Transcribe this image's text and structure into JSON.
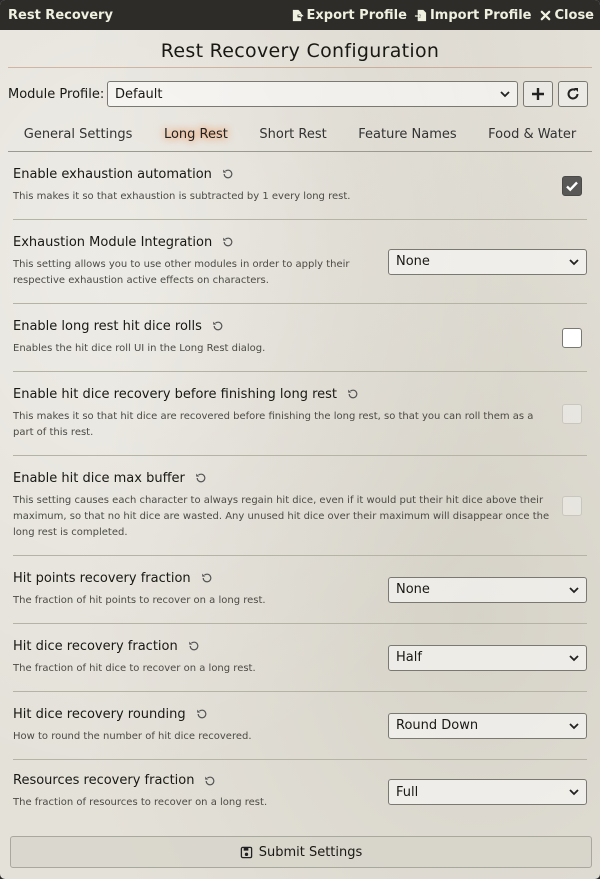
{
  "window": {
    "title": "Rest Recovery",
    "export_label": "Export Profile",
    "import_label": "Import Profile",
    "close_label": "Close"
  },
  "heading": "Rest Recovery Configuration",
  "profile": {
    "label": "Module Profile:",
    "value": "Default"
  },
  "tabs": [
    {
      "label": "General Settings",
      "active": false
    },
    {
      "label": "Long Rest",
      "active": true
    },
    {
      "label": "Short Rest",
      "active": false
    },
    {
      "label": "Feature Names",
      "active": false
    },
    {
      "label": "Food & Water",
      "active": false
    }
  ],
  "settings": [
    {
      "label": "Enable exhaustion automation",
      "hint": "This makes it so that exhaustion is subtracted by 1 every long rest.",
      "control": "checkbox",
      "checked": true,
      "disabled": false
    },
    {
      "label": "Exhaustion Module Integration",
      "hint": "This setting allows you to use other modules in order to apply their respective exhaustion active effects on characters.",
      "control": "select",
      "value": "None"
    },
    {
      "label": "Enable long rest hit dice rolls",
      "hint": "Enables the hit dice roll UI in the Long Rest dialog.",
      "control": "checkbox",
      "checked": false,
      "disabled": false
    },
    {
      "label": "Enable hit dice recovery before finishing long rest",
      "hint": "This makes it so that hit dice are recovered before finishing the long rest, so that you can roll them as a part of this rest.",
      "control": "checkbox",
      "checked": false,
      "disabled": true
    },
    {
      "label": "Enable hit dice max buffer",
      "hint": "This setting causes each character to always regain hit dice, even if it would put their hit dice above their maximum, so that no hit dice are wasted. Any unused hit dice over their maximum will disappear once the long rest is completed.",
      "control": "checkbox",
      "checked": false,
      "disabled": true
    },
    {
      "label": "Hit points recovery fraction",
      "hint": "The fraction of hit points to recover on a long rest.",
      "control": "select",
      "value": "None"
    },
    {
      "label": "Hit dice recovery fraction",
      "hint": "The fraction of hit dice to recover on a long rest.",
      "control": "select",
      "value": "Half"
    },
    {
      "label": "Hit dice recovery rounding",
      "hint": "How to round the number of hit dice recovered.",
      "control": "select",
      "value": "Round Down"
    },
    {
      "label": "Resources recovery fraction",
      "hint": "The fraction of resources to recover on a long rest.",
      "control": "select",
      "value": "Full"
    }
  ],
  "submit_label": "Submit Settings",
  "colors": {
    "titlebar": "#2d2c29",
    "active_tab_glow": "#ff6400",
    "checked_box": "#595857"
  }
}
